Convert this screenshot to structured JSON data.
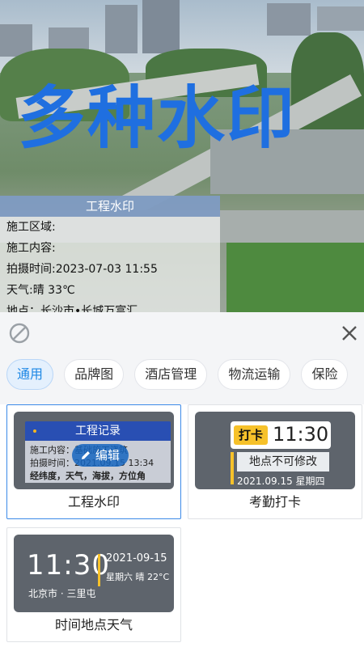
{
  "photo": {
    "big_title": "多种水印",
    "watermark": {
      "header": "工程水印",
      "lines": [
        "施工区域:",
        "施工内容:",
        "拍摄时间:2023-07-03 11:55",
        "天气:晴 33℃",
        "地点：长沙市•长城万富汇"
      ]
    }
  },
  "toolbar": {
    "none_icon": "no-watermark-icon",
    "close_icon": "close-icon"
  },
  "tabs": [
    "通用",
    "品牌图",
    "酒店管理",
    "物流运输",
    "保险"
  ],
  "templates": [
    {
      "label": "工程水印",
      "thumb": {
        "header": "工程记录",
        "line1": "施工内容：基础施工浇筑",
        "line2": "拍摄时间：2021.09.15 13:34",
        "line3": "经纬度，天气，海拔，方位角",
        "edit": "编辑"
      }
    },
    {
      "label": "考勤打卡",
      "thumb": {
        "tag": "打卡",
        "time": "11:30",
        "place": "地点不可修改",
        "date": "2021.09.15  星期四"
      }
    },
    {
      "label": "时间地点天气",
      "thumb": {
        "time": "11:30",
        "date": "2021-09-15",
        "week": "星期六 晴 22°C",
        "loc": "北京市 · 三里屯"
      }
    }
  ],
  "colors": {
    "accent": "#1e88e5",
    "title_blue": "#1f6fe0",
    "tag_yellow": "#f6c12a"
  }
}
